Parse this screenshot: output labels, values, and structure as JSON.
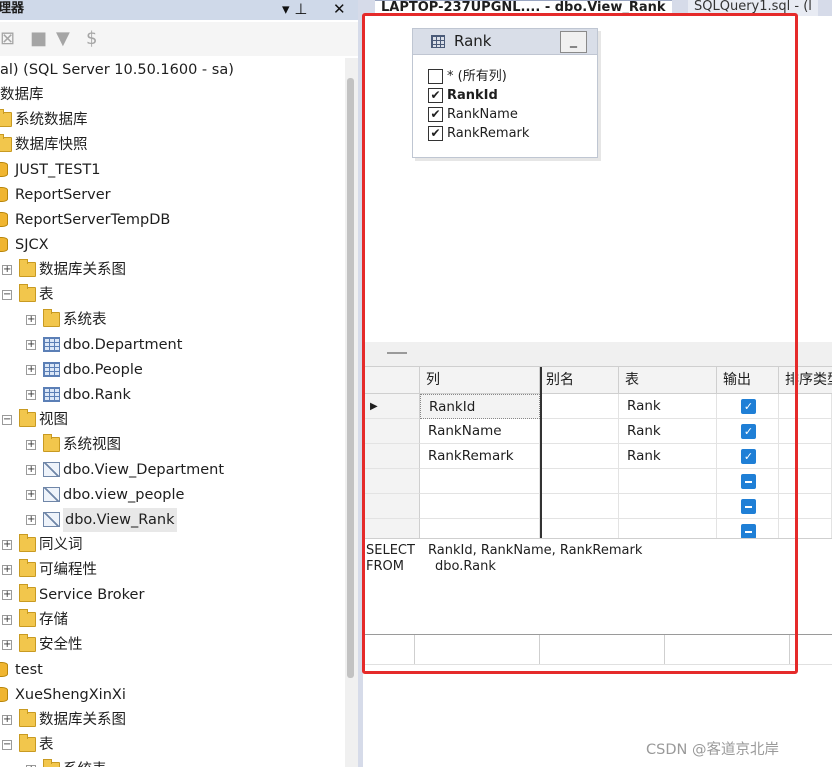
{
  "explorer": {
    "title": "理器",
    "pin_glyph": "▾ ⊥",
    "close_glyph": "✕",
    "server": "al) (SQL Server 10.50.1600 - sa)",
    "tree": [
      {
        "label": "数据库",
        "level": 0,
        "icon": "none",
        "exp": "none"
      },
      {
        "label": "系统数据库",
        "level": 1,
        "icon": "folder",
        "exp": "none"
      },
      {
        "label": "数据库快照",
        "level": 1,
        "icon": "folder",
        "exp": "none"
      },
      {
        "label": "JUST_TEST1",
        "level": 1,
        "icon": "database",
        "exp": "none"
      },
      {
        "label": "ReportServer",
        "level": 1,
        "icon": "database",
        "exp": "none"
      },
      {
        "label": "ReportServerTempDB",
        "level": 1,
        "icon": "database",
        "exp": "none"
      },
      {
        "label": "SJCX",
        "level": 1,
        "icon": "database",
        "exp": "none"
      },
      {
        "label": "数据库关系图",
        "level": 2,
        "icon": "folder",
        "exp": "plus"
      },
      {
        "label": "表",
        "level": 2,
        "icon": "folder",
        "exp": "minus"
      },
      {
        "label": "系统表",
        "level": 3,
        "icon": "folder",
        "exp": "plus"
      },
      {
        "label": "dbo.Department",
        "level": 3,
        "icon": "table",
        "exp": "plus"
      },
      {
        "label": "dbo.People",
        "level": 3,
        "icon": "table",
        "exp": "plus"
      },
      {
        "label": "dbo.Rank",
        "level": 3,
        "icon": "table",
        "exp": "plus"
      },
      {
        "label": "视图",
        "level": 2,
        "icon": "folder",
        "exp": "minus"
      },
      {
        "label": "系统视图",
        "level": 3,
        "icon": "folder",
        "exp": "plus"
      },
      {
        "label": "dbo.View_Department",
        "level": 3,
        "icon": "view",
        "exp": "plus"
      },
      {
        "label": "dbo.view_people",
        "level": 3,
        "icon": "view",
        "exp": "plus"
      },
      {
        "label": "dbo.View_Rank",
        "level": 3,
        "icon": "view",
        "exp": "plus",
        "selected": true
      },
      {
        "label": "同义词",
        "level": 2,
        "icon": "folder",
        "exp": "plus"
      },
      {
        "label": "可编程性",
        "level": 2,
        "icon": "folder",
        "exp": "plus"
      },
      {
        "label": "Service Broker",
        "level": 2,
        "icon": "folder",
        "exp": "plus"
      },
      {
        "label": "存储",
        "level": 2,
        "icon": "folder",
        "exp": "plus"
      },
      {
        "label": "安全性",
        "level": 2,
        "icon": "folder",
        "exp": "plus"
      },
      {
        "label": "test",
        "level": 1,
        "icon": "database",
        "exp": "none"
      },
      {
        "label": "XueShengXinXi",
        "level": 1,
        "icon": "database",
        "exp": "none"
      },
      {
        "label": "数据库关系图",
        "level": 2,
        "icon": "folder",
        "exp": "plus"
      },
      {
        "label": "表",
        "level": 2,
        "icon": "folder",
        "exp": "minus"
      },
      {
        "label": "系统表",
        "level": 3,
        "icon": "folder",
        "exp": "plus"
      }
    ]
  },
  "tabs": {
    "active": "LAPTOP-237UPGNL.... - dbo.View_Rank",
    "inactive": "SQLQuery1.sql - (l"
  },
  "diagram": {
    "table_name": "Rank",
    "min_label": "_",
    "columns": [
      {
        "label": "* (所有列)",
        "checked": false,
        "bold": false
      },
      {
        "label": "RankId",
        "checked": true,
        "bold": true
      },
      {
        "label": "RankName",
        "checked": true,
        "bold": false
      },
      {
        "label": "RankRemark",
        "checked": true,
        "bold": false
      }
    ]
  },
  "grid": {
    "headers": [
      "列",
      "别名",
      "表",
      "输出",
      "排序类型"
    ],
    "current_row_glyph": "▶",
    "rows": [
      {
        "column": "RankId",
        "alias": "",
        "table": "Rank",
        "output": "checked"
      },
      {
        "column": "RankName",
        "alias": "",
        "table": "Rank",
        "output": "checked"
      },
      {
        "column": "RankRemark",
        "alias": "",
        "table": "Rank",
        "output": "checked"
      },
      {
        "column": "",
        "alias": "",
        "table": "",
        "output": "indeterminate"
      },
      {
        "column": "",
        "alias": "",
        "table": "",
        "output": "indeterminate"
      },
      {
        "column": "",
        "alias": "",
        "table": "",
        "output": "indeterminate"
      }
    ]
  },
  "sql": {
    "select_kw": "SELECT",
    "select_cols": "RankId, RankName, RankRemark",
    "from_kw": "FROM",
    "from_table": "dbo.Rank"
  },
  "watermark": "CSDN @客道京北岸",
  "colors": {
    "highlight": "#e52a2a",
    "checkbox_blue": "#1f7fd6",
    "folder": "#f2c64c"
  }
}
